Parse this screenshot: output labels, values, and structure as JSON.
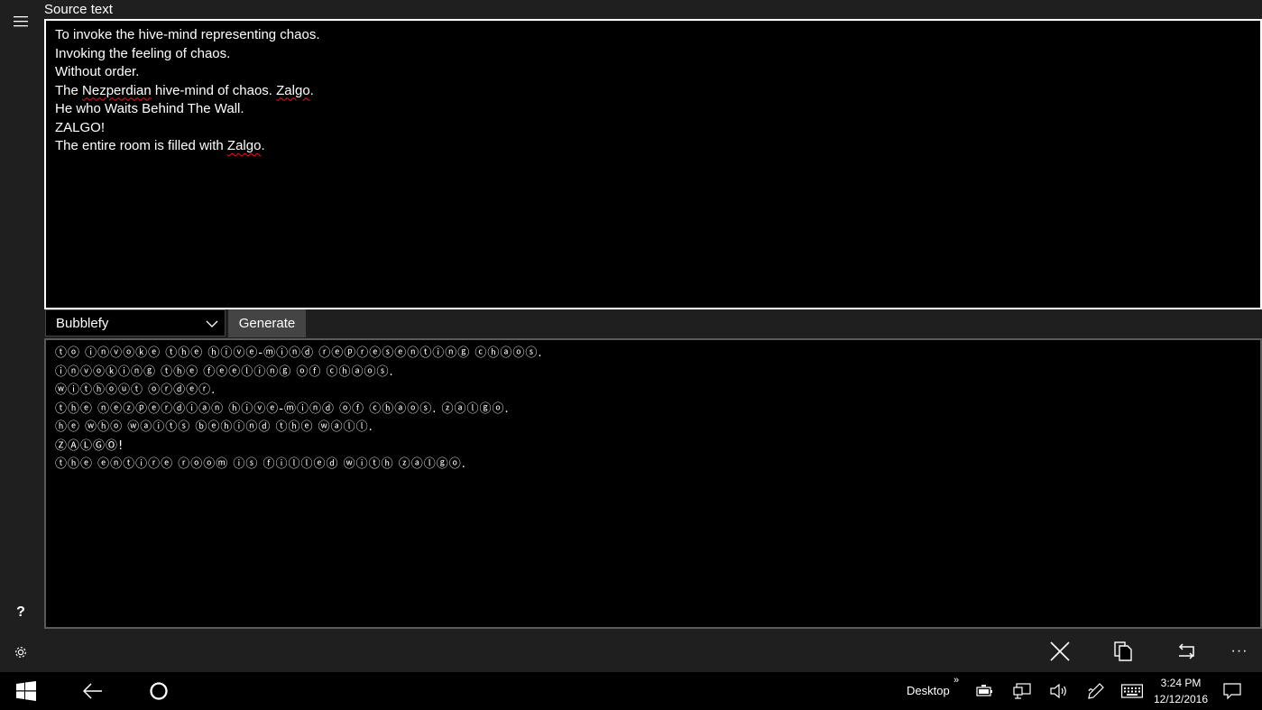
{
  "source": {
    "label": "Source text",
    "lines": [
      {
        "segments": [
          {
            "text": "To invoke the hive-mind representing chaos.",
            "err": false
          }
        ]
      },
      {
        "segments": [
          {
            "text": "Invoking the feeling of chaos.",
            "err": false
          }
        ]
      },
      {
        "segments": [
          {
            "text": "Without order.",
            "err": false
          }
        ]
      },
      {
        "segments": [
          {
            "text": "The ",
            "err": false
          },
          {
            "text": "Nezperdian",
            "err": true
          },
          {
            "text": " hive-mind of chaos. ",
            "err": false
          },
          {
            "text": "Zalgo",
            "err": true
          },
          {
            "text": ".",
            "err": false
          }
        ]
      },
      {
        "segments": [
          {
            "text": "He who Waits Behind The Wall.",
            "err": false
          }
        ]
      },
      {
        "segments": [
          {
            "text": "ZALGO!",
            "err": false
          }
        ]
      },
      {
        "segments": [
          {
            "text": "The entire room is filled with ",
            "err": false
          },
          {
            "text": "Zalgo",
            "err": true
          },
          {
            "text": ".",
            "err": false
          }
        ]
      }
    ]
  },
  "controls": {
    "mode_selected": "Bubblefy",
    "generate_label": "Generate"
  },
  "output": {
    "lines": [
      "ⓣⓞ ⓘⓝⓥⓞⓚⓔ ⓣⓗⓔ ⓗⓘⓥⓔ-ⓜⓘⓝⓓ ⓡⓔⓟⓡⓔⓢⓔⓝⓣⓘⓝⓖ ⓒⓗⓐⓞⓢ.",
      "ⓘⓝⓥⓞⓚⓘⓝⓖ ⓣⓗⓔ ⓕⓔⓔⓛⓘⓝⓖ ⓞⓕ ⓒⓗⓐⓞⓢ.",
      "ⓦⓘⓣⓗⓞⓤⓣ ⓞⓡⓓⓔⓡ.",
      "ⓣⓗⓔ ⓝⓔⓩⓟⓔⓡⓓⓘⓐⓝ ⓗⓘⓥⓔ-ⓜⓘⓝⓓ ⓞⓕ ⓒⓗⓐⓞⓢ. ⓩⓐⓛⓖⓞ.",
      "ⓗⓔ ⓦⓗⓞ ⓦⓐⓘⓣⓢ ⓑⓔⓗⓘⓝⓓ ⓣⓗⓔ ⓦⓐⓛⓛ.",
      "ⓏⒶⓁⒼⓄ!",
      "ⓣⓗⓔ ⓔⓝⓣⓘⓡⓔ ⓡⓞⓞⓜ ⓘⓢ ⓕⓘⓛⓛⓔⓓ ⓦⓘⓣⓗ ⓩⓐⓛⓖⓞ."
    ]
  },
  "sidebar": {
    "help_glyph": "?",
    "icons": [
      "hamburger-menu-icon",
      "help-icon",
      "gear-icon"
    ]
  },
  "command_bar": {
    "icons": [
      "close-icon",
      "copy-icon",
      "share-icon",
      "more-icon"
    ],
    "more_glyph": "···"
  },
  "taskbar": {
    "desktop_label": "Desktop",
    "chevron": "»",
    "time": "3:24 PM",
    "date": "12/12/2016",
    "icons": [
      "windows-start-icon",
      "back-arrow-icon",
      "cortana-icon",
      "battery-icon",
      "network-icon",
      "volume-icon",
      "pen-icon",
      "keyboard-icon",
      "notifications-icon"
    ]
  },
  "colors": {
    "background": "#000000",
    "chrome": "#1f1f1f",
    "accent_error": "#e81123",
    "button": "#444444"
  }
}
